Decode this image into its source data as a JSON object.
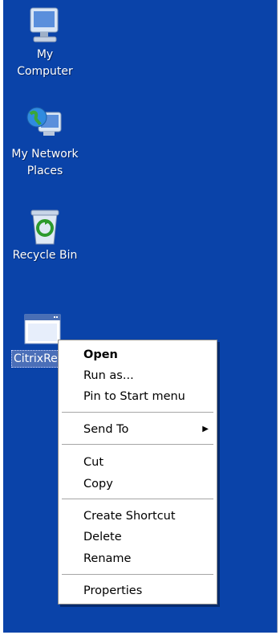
{
  "desktop": {
    "icons": [
      {
        "label": "My Computer",
        "icon": "my-computer-icon"
      },
      {
        "label": "My Network Places",
        "icon": "network-places-icon"
      },
      {
        "label": "Recycle Bin",
        "icon": "recycle-bin-icon"
      },
      {
        "label": "CitrixRe… Web.",
        "icon": "app-window-icon"
      }
    ]
  },
  "context_menu": {
    "items": [
      {
        "label": "Open"
      },
      {
        "label": "Run as..."
      },
      {
        "label": "Pin to Start menu"
      },
      {
        "label": "Send To"
      },
      {
        "label": "Cut"
      },
      {
        "label": "Copy"
      },
      {
        "label": "Create Shortcut"
      },
      {
        "label": "Delete"
      },
      {
        "label": "Rename"
      },
      {
        "label": "Properties"
      }
    ]
  },
  "colors": {
    "desktop_bg": "#0a43a9",
    "menu_bg": "#ffffff"
  }
}
